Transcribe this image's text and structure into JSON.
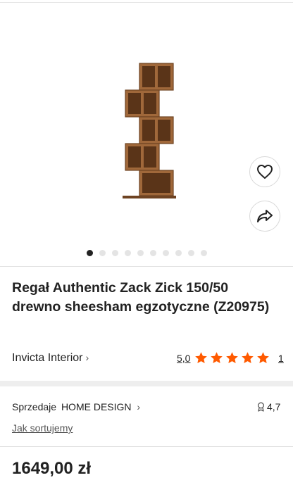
{
  "product": {
    "title": "Regał Authentic Zack Zick 150/50 drewno sheesham egzotyczne (Z20975)",
    "image_alt": "wooden zig-zag bookshelf",
    "price": "1649,00 zł"
  },
  "gallery": {
    "slide_count": 10,
    "active_index": 0,
    "favorite_icon": "heart-icon",
    "share_icon": "share-arrow-icon"
  },
  "brand": {
    "name": "Invicta Interior",
    "chevron": "›"
  },
  "rating": {
    "score": "5,0",
    "stars": 5,
    "count": "1",
    "star_color": "#ff5a00"
  },
  "seller": {
    "prefix": "Sprzedaje",
    "name": "HOME DESIGN",
    "chevron": "›",
    "score": "4,7",
    "score_icon": "seller-badge-icon",
    "sort_link": "Jak sortujemy"
  }
}
